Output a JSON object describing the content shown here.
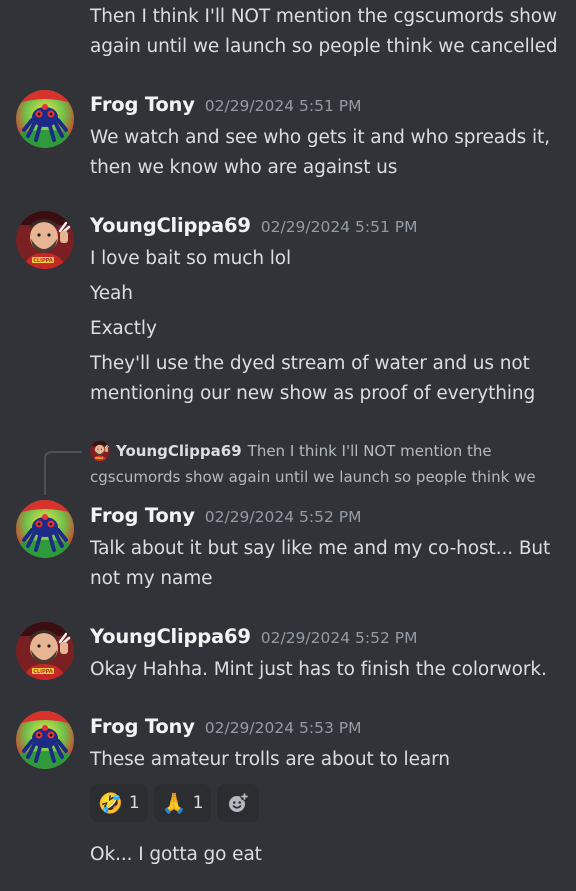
{
  "messages": {
    "m0": {
      "lines": [
        "Then I think I'll NOT mention the cgscumords show",
        "again until we launch so people think we cancelled"
      ]
    },
    "m1": {
      "author": "Frog Tony",
      "timestamp": "02/29/2024 5:51 PM",
      "lines": [
        "We watch and see who gets it and who spreads it,",
        "then we know who are against us"
      ]
    },
    "m2": {
      "author": "YoungClippa69",
      "timestamp": "02/29/2024 5:51 PM",
      "lines": [
        "I love bait so much lol",
        "Yeah",
        "Exactly",
        "They'll use the dyed stream of water and us not",
        "mentioning our new show as proof of everything"
      ]
    },
    "m3": {
      "reply": {
        "author": "YoungClippa69",
        "text": "Then I think I'll NOT mention the",
        "text2": "cgscumords show again until we launch so people think we"
      },
      "author": "Frog Tony",
      "timestamp": "02/29/2024 5:52 PM",
      "lines": [
        "Talk about it but say like me and my co-host... But",
        "not my name"
      ]
    },
    "m4": {
      "author": "YoungClippa69",
      "timestamp": "02/29/2024 5:52 PM",
      "lines": [
        "Okay Hahha. Mint just has to finish the colorwork."
      ]
    },
    "m5": {
      "author": "Frog Tony",
      "timestamp": "02/29/2024 5:53 PM",
      "lines": [
        "These amateur trolls are about to learn"
      ],
      "reactions": [
        {
          "emoji": "🤣",
          "icon": "rofl-emoji",
          "count": "1"
        },
        {
          "emoji": "🙏",
          "icon": "pray-emoji",
          "count": "1"
        }
      ],
      "add_reaction_icon": "add-reaction-icon",
      "followup": "Ok... I gotta go eat"
    }
  },
  "colors": {
    "background": "#313338",
    "text": "#dbdee1",
    "author": "#f2f3f5",
    "timestamp": "#949ba4",
    "reaction_bg": "#2b2d31"
  }
}
